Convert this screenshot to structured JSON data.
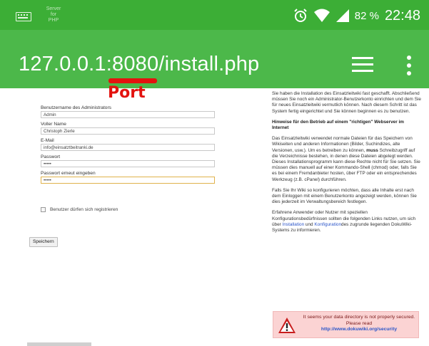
{
  "status_bar": {
    "notification_text": [
      "Server",
      "for",
      "PHP"
    ],
    "battery": "82 %",
    "time": "22:48"
  },
  "browser": {
    "url": "127.0.0.1:8080/install.php"
  },
  "annotation": {
    "label": "Port",
    "color": "#e3130f"
  },
  "form": {
    "fields": [
      {
        "label": "Benutzername des Administrators",
        "value": "Admin"
      },
      {
        "label": "Voller Name",
        "value": "Christoph Zierle"
      },
      {
        "label": "E-Mail",
        "value": "info@einsatztbeitranki.de"
      },
      {
        "label": "Passwort",
        "value": "•••••"
      },
      {
        "label": "Passwort erneut eingeben",
        "value": "•••••"
      }
    ],
    "checkbox_label": "Benutzer dürfen sich registrieren",
    "save_button": "Speichern"
  },
  "sidebar": {
    "intro": "Sie haben die Installation des Einsatzleitwiki fast geschafft. Abschließend müssen Sie noch ein Administrator-Benutzerkonto einrichten und dem Sie für neues Einsatzleitwiki vermutlich können. Nach diesem Schritt ist das System fertig eingerichtet und Sie können beginnen es zu benutzen.",
    "heading": "Hinweise für den Betrieb auf einem \"richtigen\" Webserver im Internet",
    "body1_a": "Das Einsatzleitwiki verwendet normale Dateien für das Speichern von Wikiseiten und anderen Informationen (Bilder, Suchindizes, alte Versionen, usw.). Um es betreiben zu können,",
    "body1_bold": "muss",
    "body1_b": "Schreibzugriff auf die Verzeichnisse bestehen, in denen diese Dateien abgelegt werden. Dieses Installationsprogramm kann diese Rechte nicht für Sie setzen. Sie müssen dies manuell auf einer Kommando-Shell (chmod) oder, falls Sie es bei einem Fremdanbieter hosten, über FTP oder ein entsprechendes Werkzeug (z.B. cPanel) durchführen.",
    "body2": "Falls Sie Ihr Wiki so konfigurieren möchten, dass alle Inhalte erst nach dem Einloggen mit einem Benutzerkonto angezeigt werden, können Sie dies jederzeit im Verwaltungsbereich festlegen.",
    "body3_a": "Erfahrene Anwender oder Nutzer mit speziellen Konfigurationsbedürfnissen sollten die folgenden Links nutzen, um sich über",
    "link1": "Installation",
    "body3_b": "und",
    "link2": "Konfiguration",
    "body3_c": "des zugrunde liegenden DokuWiki-Systems zu informieren."
  },
  "warning": {
    "line1": "It seems your data directory is not properly secured. Please read",
    "link": "http://www.dokuwiki.org/security"
  }
}
